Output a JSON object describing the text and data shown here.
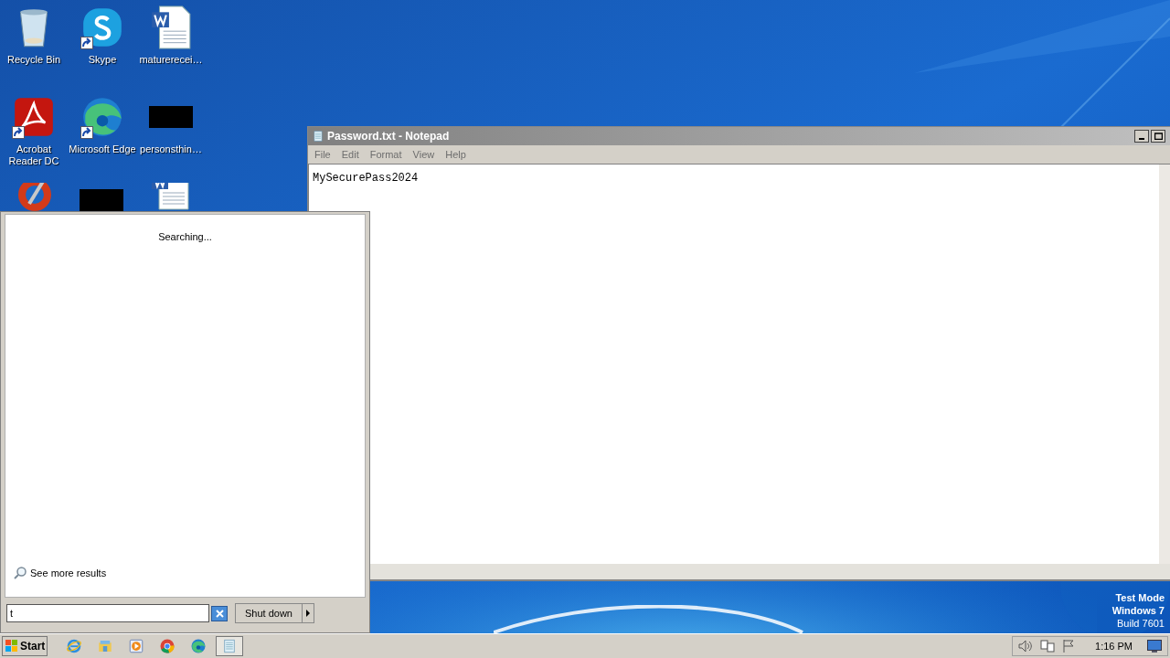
{
  "desktop_icons": [
    {
      "label": "Recycle Bin",
      "kind": "recycle",
      "shortcut": false
    },
    {
      "label": "Skype",
      "kind": "skype",
      "shortcut": true
    },
    {
      "label": "maturerecei…",
      "kind": "word",
      "shortcut": false
    },
    {
      "label": "Acrobat Reader DC",
      "kind": "acrobat",
      "shortcut": true
    },
    {
      "label": "Microsoft Edge",
      "kind": "edge",
      "shortcut": true
    },
    {
      "label": "personsthin…",
      "kind": "black",
      "shortcut": false
    }
  ],
  "partly_hidden_icons": [
    {
      "kind": "ccleaner"
    },
    {
      "kind": "black"
    },
    {
      "kind": "word"
    }
  ],
  "notepad": {
    "title": "Password.txt - Notepad",
    "menu": [
      "File",
      "Edit",
      "Format",
      "View",
      "Help"
    ],
    "content": "MySecurePass2024"
  },
  "start_menu": {
    "status": "Searching...",
    "see_more": "See more results",
    "search": {
      "value": "t"
    },
    "shutdown": "Shut down"
  },
  "system_watermark": [
    "Test Mode",
    "Windows 7",
    "Build 7601"
  ],
  "taskbar": {
    "start": "Start",
    "pinned": [
      {
        "kind": "ie",
        "selected": false
      },
      {
        "kind": "explorer",
        "selected": false
      },
      {
        "kind": "media",
        "selected": false
      },
      {
        "kind": "chrome",
        "selected": false
      },
      {
        "kind": "edge",
        "selected": false
      },
      {
        "kind": "notepad",
        "selected": true
      }
    ],
    "clock": "1:16 PM"
  }
}
